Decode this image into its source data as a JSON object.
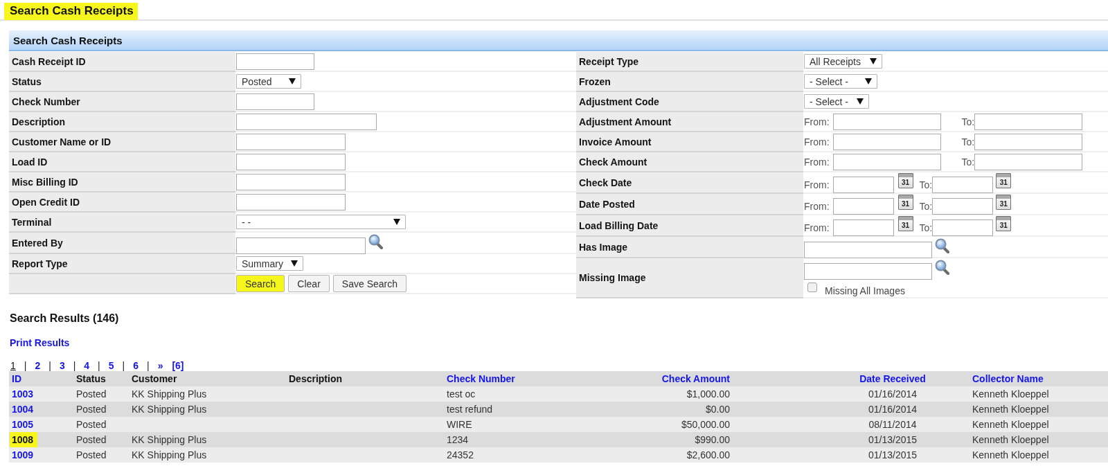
{
  "page_title": {
    "text": "Search Cash Receipts",
    "highlighted": true
  },
  "search_panel": {
    "title": "Search Cash Receipts",
    "left_fields": [
      {
        "label": "Cash Receipt ID",
        "kind": "text"
      },
      {
        "label": "Status",
        "kind": "select",
        "value": "Posted"
      },
      {
        "label": "Check Number",
        "kind": "text"
      },
      {
        "label": "Description",
        "kind": "text"
      },
      {
        "label": "Customer Name or ID",
        "kind": "text"
      },
      {
        "label": "Load ID",
        "kind": "text"
      },
      {
        "label": "Misc Billing ID",
        "kind": "text"
      },
      {
        "label": "Open Credit ID",
        "kind": "text"
      },
      {
        "label": "Terminal",
        "kind": "select",
        "value": "- -"
      },
      {
        "label": "Entered By",
        "kind": "lookup"
      },
      {
        "label": "Report Type",
        "kind": "select",
        "value": "Summary"
      }
    ],
    "buttons": [
      {
        "label": "Search",
        "highlighted": true
      },
      {
        "label": "Clear",
        "highlighted": false
      },
      {
        "label": "Save Search",
        "highlighted": false
      }
    ],
    "right_fields": [
      {
        "label": "Receipt Type",
        "kind": "select",
        "value": "All Receipts"
      },
      {
        "label": "Frozen",
        "kind": "select",
        "value": "- Select -"
      },
      {
        "label": "Adjustment Code",
        "kind": "select",
        "value": "- Select -"
      },
      {
        "label": "Adjustment Amount",
        "kind": "range",
        "from_label": "From:",
        "to_label": "To:"
      },
      {
        "label": "Invoice Amount",
        "kind": "range",
        "from_label": "From:",
        "to_label": "To:"
      },
      {
        "label": "Check Amount",
        "kind": "range",
        "from_label": "From:",
        "to_label": "To:"
      },
      {
        "label": "Check Date",
        "kind": "date_range",
        "from_label": "From:",
        "to_label": "To:",
        "calendar_buttons": [
          "31",
          "31"
        ]
      },
      {
        "label": "Date Posted",
        "kind": "date_range",
        "from_label": "From:",
        "to_label": "To:",
        "calendar_buttons": [
          "31",
          "31"
        ]
      },
      {
        "label": "Load Billing Date",
        "kind": "date_range",
        "from_label": "From:",
        "to_label": "To:",
        "calendar_buttons": [
          "31",
          "31"
        ]
      },
      {
        "label": "Has Image",
        "kind": "lookup"
      },
      {
        "label": "Missing Image",
        "kind": "lookup",
        "checkbox": {
          "label": "Missing All Images",
          "checked": false
        }
      }
    ]
  },
  "results": {
    "title": "Search Results (146)",
    "print_link": "Print Results",
    "pagination": [
      {
        "label": "1",
        "selected": true,
        "separator": "|"
      },
      {
        "label": "2",
        "selected": false,
        "separator": "|"
      },
      {
        "label": "3",
        "selected": false,
        "separator": "|"
      },
      {
        "label": "4",
        "selected": false,
        "separator": "|"
      },
      {
        "label": "5",
        "selected": false,
        "separator": "|"
      },
      {
        "label": "6",
        "selected": false,
        "separator": "|"
      },
      {
        "label": "»",
        "selected": false
      },
      {
        "label": "[6]",
        "selected": false
      }
    ],
    "table": {
      "columns": [
        {
          "label": "ID",
          "sortable": true
        },
        {
          "label": "Status",
          "sortable": false
        },
        {
          "label": "Customer",
          "sortable": false
        },
        {
          "label": "Description",
          "sortable": false
        },
        {
          "label": "Check Number",
          "sortable": true
        },
        {
          "label": "Check Amount",
          "sortable": true
        },
        {
          "label": "Date Received",
          "sortable": true
        },
        {
          "label": "Collector Name",
          "sortable": true
        }
      ],
      "rows": [
        {
          "id": "1003",
          "status": "Posted",
          "customer": "KK Shipping Plus",
          "check_number": "test oc",
          "check_amount": "$1,000.00",
          "date_received": "01/16/2014",
          "collector_name": "Kenneth Kloeppel",
          "highlighted": false
        },
        {
          "id": "1004",
          "status": "Posted",
          "customer": "KK Shipping Plus",
          "check_number": "test refund",
          "check_amount": "$0.00",
          "date_received": "01/16/2014",
          "collector_name": "Kenneth Kloeppel",
          "highlighted": false
        },
        {
          "id": "1005",
          "status": "Posted",
          "check_number": "WIRE",
          "check_amount": "$50,000.00",
          "date_received": "08/11/2014",
          "collector_name": "Kenneth Kloeppel",
          "highlighted": false
        },
        {
          "id": "1008",
          "status": "Posted",
          "customer": "KK Shipping Plus",
          "check_number": "1234",
          "check_amount": "$990.00",
          "date_received": "01/13/2015",
          "collector_name": "Kenneth Kloeppel",
          "highlighted": true
        },
        {
          "id": "1009",
          "status": "Posted",
          "customer": "KK Shipping Plus",
          "check_number": "24352",
          "check_amount": "$2,600.00",
          "date_received": "01/13/2015",
          "collector_name": "Kenneth Kloeppel",
          "highlighted": false
        }
      ]
    }
  }
}
